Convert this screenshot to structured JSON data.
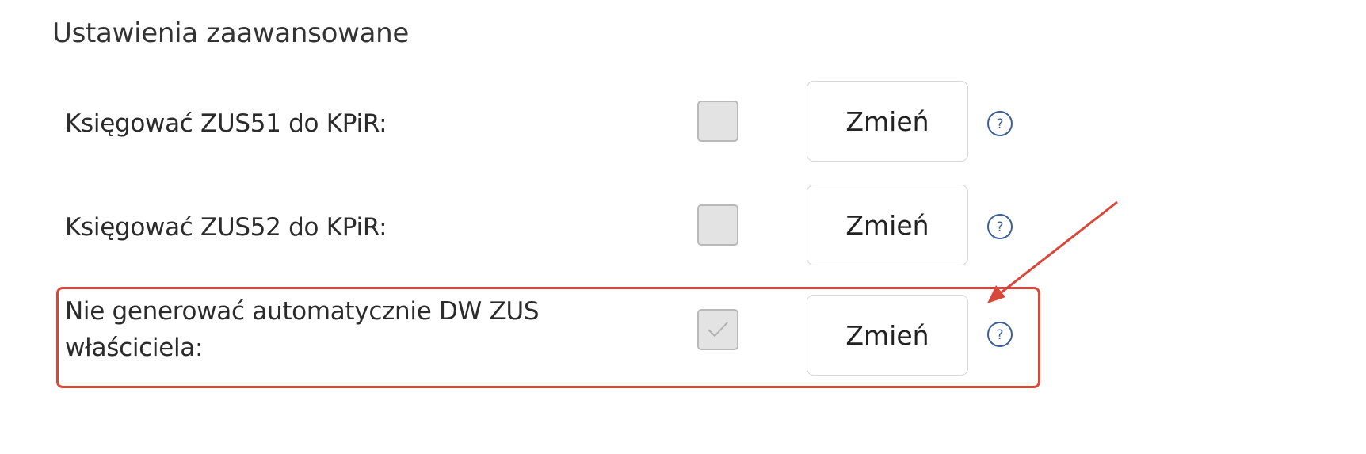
{
  "section": {
    "title": "Ustawienia zaawansowane"
  },
  "settings": [
    {
      "label": "Księgować ZUS51 do KPiR:",
      "checked": false,
      "button_label": "Zmień",
      "help_icon": "question-circle-icon"
    },
    {
      "label": "Księgować ZUS52 do KPiR:",
      "checked": false,
      "button_label": "Zmień",
      "help_icon": "question-circle-icon"
    },
    {
      "label_line1": "Nie generować automatycznie DW ZUS",
      "label_line2": "właściciela:",
      "checked": true,
      "button_label": "Zmień",
      "help_icon": "question-circle-icon"
    }
  ],
  "annotation": {
    "highlight_color": "#d9473a",
    "arrow_color": "#d9473a"
  },
  "colors": {
    "help_icon": "#3b5f96",
    "checkbox_fill": "#e3e3e3",
    "checkbox_border": "#b9b9b9"
  }
}
